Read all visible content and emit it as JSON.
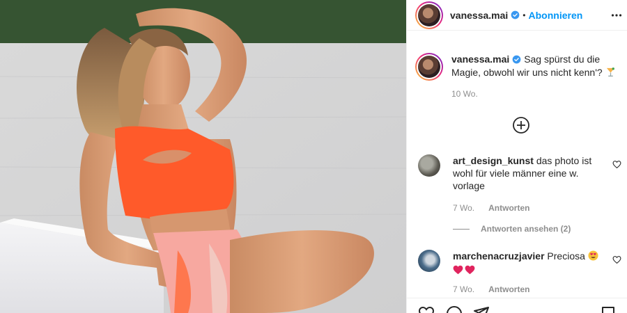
{
  "header": {
    "username": "vanessa.mai",
    "separator": "•",
    "follow_label": "Abonnieren"
  },
  "caption": {
    "username": "vanessa.mai",
    "text": "Sag spürst du die Magie, obwohl wir uns nicht kenn'?",
    "time": "10 Wo."
  },
  "comments": [
    {
      "username": "art_design_kunst",
      "text": "das photo ist wohl für viele männer eine w. vorlage",
      "time": "7 Wo.",
      "reply_label": "Antworten",
      "view_replies": "Antworten ansehen (2)"
    },
    {
      "username": "marchenacruzjavier",
      "text": "Preciosa",
      "time": "7 Wo.",
      "reply_label": "Antworten"
    }
  ],
  "colors": {
    "accent": "#0095f6",
    "verified": "#3897f0",
    "muted": "#8e8e8e",
    "swimsuit": "#ff5a2a"
  },
  "icons": [
    "verified-icon",
    "more-options-icon",
    "load-more-comments-icon",
    "heart-icon",
    "comment-icon",
    "share-icon",
    "bookmark-icon"
  ]
}
